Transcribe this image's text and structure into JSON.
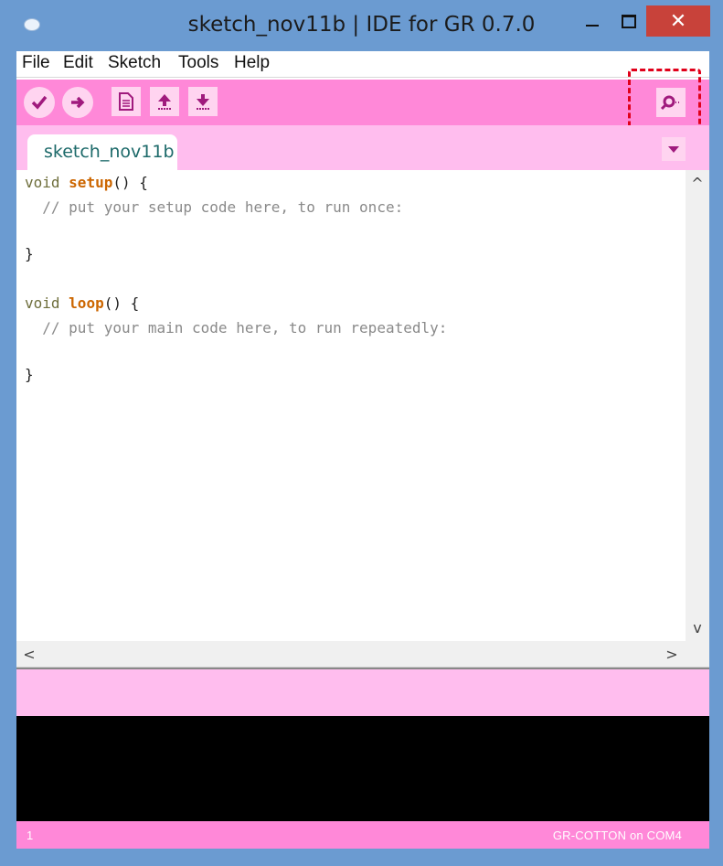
{
  "window": {
    "title": "sketch_nov11b | IDE for GR 0.7.0",
    "close_glyph": "✕"
  },
  "menu": [
    "File",
    "Edit",
    "Sketch",
    "Tools",
    "Help"
  ],
  "toolbar": {
    "buttons": [
      "verify-icon",
      "upload-icon",
      "new-icon",
      "open-icon",
      "save-icon"
    ],
    "serial_monitor_icon": "serial-monitor-icon",
    "accent_color": "#ff88d8",
    "highlight_color": "#e0001a"
  },
  "tab": {
    "name": "sketch_nov11b"
  },
  "code": {
    "setup_kw": "void",
    "setup_fn": "setup",
    "setup_open": "() {",
    "setup_comment": "  // put your setup code here, to run once:",
    "setup_close": "}",
    "loop_kw": "void",
    "loop_fn": "loop",
    "loop_open": "() {",
    "loop_comment": "  // put your main code here, to run repeatedly:",
    "loop_close": "}"
  },
  "scroll": {
    "up": "^",
    "down": "v",
    "left": "<",
    "right": ">"
  },
  "status": {
    "line": "1",
    "board": "GR-COTTON on COM4"
  }
}
